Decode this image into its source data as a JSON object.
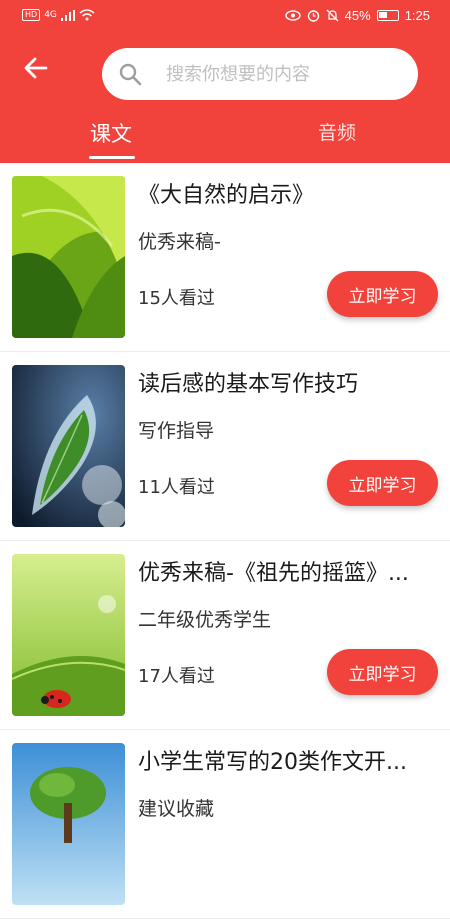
{
  "status_bar": {
    "left_badge": "HD",
    "network": "4G",
    "battery_percent": "45%",
    "time": "1:25"
  },
  "search": {
    "placeholder": "搜索你想要的内容"
  },
  "tabs": [
    {
      "label": "课文",
      "active": true
    },
    {
      "label": "音频",
      "active": false
    }
  ],
  "items": [
    {
      "title": "《大自然的启示》",
      "subtitle": "优秀来稿-",
      "views": "15人看过",
      "button": "立即学习",
      "thumb": "green-abstract"
    },
    {
      "title": "读后感的基本写作技巧",
      "subtitle": "写作指导",
      "views": "11人看过",
      "button": "立即学习",
      "thumb": "frozen-leaf"
    },
    {
      "title": "优秀来稿-《祖先的摇篮》...",
      "subtitle": "二年级优秀学生",
      "views": "17人看过",
      "button": "立即学习",
      "thumb": "ladybug-leaf"
    },
    {
      "title": "小学生常写的20类作文开...",
      "subtitle": "建议收藏",
      "views": "",
      "button": "",
      "thumb": "tree-sky"
    }
  ],
  "colors": {
    "primary": "#f2423c",
    "background": "#ffffff"
  }
}
